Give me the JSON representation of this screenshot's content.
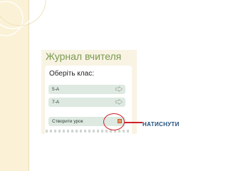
{
  "journal": {
    "title": "Журнал вчителя",
    "select_class_label": "Оберіть клас:",
    "classes": [
      {
        "label": "5-А",
        "icon": "arrow-right-icon"
      },
      {
        "label": "7-А",
        "icon": "arrow-right-icon"
      }
    ],
    "create_lesson_label": "Створити урок",
    "create_lesson_icon": "add-lesson-icon"
  },
  "annotation": {
    "label": "НАТИСНУТИ",
    "color": "#d0202a"
  },
  "colors": {
    "title": "#7a9a52",
    "row_background": "#dde9e1",
    "slide_strip": "#fbf1d6"
  }
}
